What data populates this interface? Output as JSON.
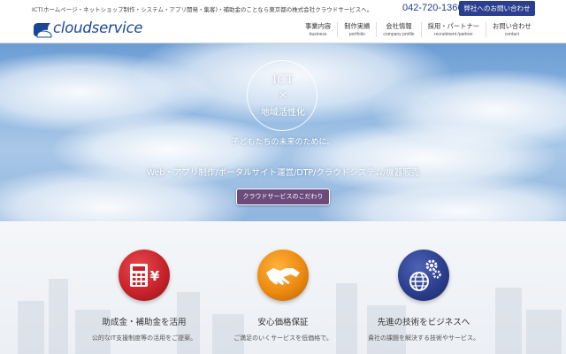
{
  "topbar": {
    "tagline": "ICT(ホームページ・ネットショップ制作・システム・アプリ開発・集客)・補助金のことなら東京都の株式会社クラウドサービスへ。",
    "phone": "042-720-1366",
    "contact_button": "弊社へのお問い合わせ"
  },
  "header": {
    "logo_text": "cloudservice",
    "nav": [
      {
        "label": "事業内容",
        "sub": "business"
      },
      {
        "label": "制作実績",
        "sub": "portfolio"
      },
      {
        "label": "会社情報",
        "sub": "company profile"
      },
      {
        "label": "採用・パートナー",
        "sub": "recruitment /partner"
      },
      {
        "label": "お問い合わせ",
        "sub": "contact"
      }
    ]
  },
  "hero": {
    "badge_line1": "ICT",
    "badge_line2": "×",
    "badge_line3": "地域活性化",
    "subtitle": "子どもたちの未来のために。",
    "services": "Web・アプリ制作/ポータルサイト運営/DTP/クラウドシステム/機器販売",
    "button": "クラウドサービスのこだわり"
  },
  "features": [
    {
      "icon": "calculator-yen-icon",
      "color": "#c8232b",
      "title": "助成金・補助金を活用",
      "desc": "公的なIT支援制度等の活用をご提案。"
    },
    {
      "icon": "handshake-icon",
      "color": "#ec8a10",
      "title": "安心価格保証",
      "desc": "ご満足のいくサービスを低価格で。"
    },
    {
      "icon": "globe-gears-icon",
      "color": "#2c3f8e",
      "title": "先進の技術をビジネスへ",
      "desc": "貴社の課題を解決する技術やサービス。"
    }
  ]
}
